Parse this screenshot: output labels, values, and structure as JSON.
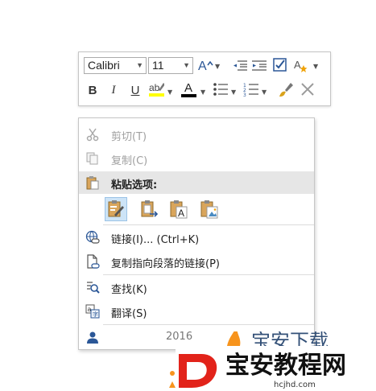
{
  "mini_toolbar": {
    "font_name": "Calibri",
    "font_size": "11",
    "buttons": {
      "bold": "B",
      "italic": "I",
      "underline": "U",
      "font_color": "A"
    }
  },
  "context_menu": {
    "items": [
      {
        "label": "剪切(T)",
        "enabled": false
      },
      {
        "label": "复制(C)",
        "enabled": false
      },
      {
        "label": "粘贴选项:",
        "enabled": true
      },
      {
        "label": "链接(I)...   (Ctrl+K)",
        "enabled": true
      },
      {
        "label": "复制指向段落的链接(P)",
        "enabled": true
      },
      {
        "label": "查找(K)",
        "enabled": true
      },
      {
        "label": "翻译(S)",
        "enabled": true
      },
      {
        "label": "2016",
        "enabled": true
      }
    ],
    "paste_options": [
      "keep-source-formatting",
      "merge-formatting",
      "keep-text-only",
      "picture"
    ]
  },
  "watermark": {
    "text": "宝安教程网",
    "url": "hcjhd.com",
    "partial_text": "宝安下载"
  },
  "colors": {
    "highlight": "#ffff00",
    "font_color_bar": "#000000",
    "paste_selected": "#cde4f7",
    "paste_header_bg": "#e6e6e6",
    "watermark_red": "#e2231a",
    "watermark_orange": "#f7941d"
  }
}
